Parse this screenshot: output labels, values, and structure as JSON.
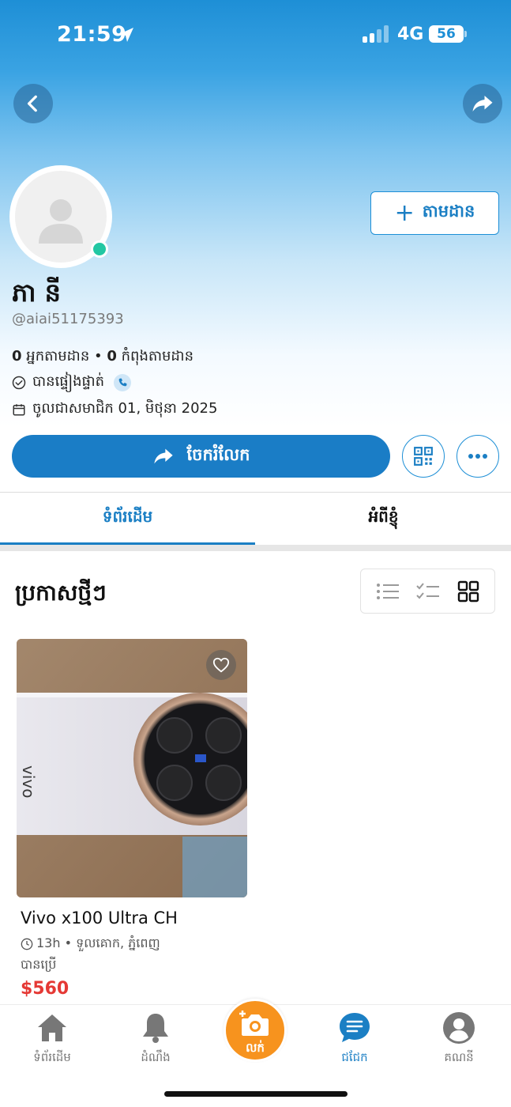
{
  "status_bar": {
    "time": "21:59",
    "network": "4G",
    "battery": "56"
  },
  "profile": {
    "name": "ភា នី",
    "handle": "@aiai51175393",
    "followers_count": "0",
    "followers_label": "អ្នកតាមដាន",
    "following_count": "0",
    "following_label": "កំពុងតាមដាន",
    "verified_label": "បានផ្ទៀងផ្ទាត់",
    "joined_label": "ចូលជាសមាជិក 01, មិថុនា 2025",
    "online": true
  },
  "actions": {
    "follow_label": "តាមដាន",
    "share_label": "ចែករំលែក"
  },
  "tabs": {
    "items": [
      "ទំព័រដើម",
      "អំពីខ្ញុំ"
    ],
    "active": 0
  },
  "section": {
    "title": "ប្រកាសថ្មីៗ",
    "active_view": "grid"
  },
  "listing": {
    "title": "Vivo x100 Ultra CH",
    "meta": "13h • ទួលគោក, ភ្នំពេញ",
    "condition": "បានប្រើ",
    "price": "$560",
    "image_brand_text": "vivo"
  },
  "bottom_nav": {
    "home_label": "ទំព័រដើម",
    "notifications_label": "ដំណឹង",
    "sell_label": "លក់",
    "chat_label": "ជជែក",
    "account_label": "គណនី"
  },
  "colors": {
    "accent": "#1b7fc4",
    "sell": "#f7931e",
    "price": "#e53935",
    "online": "#22c7a3"
  }
}
